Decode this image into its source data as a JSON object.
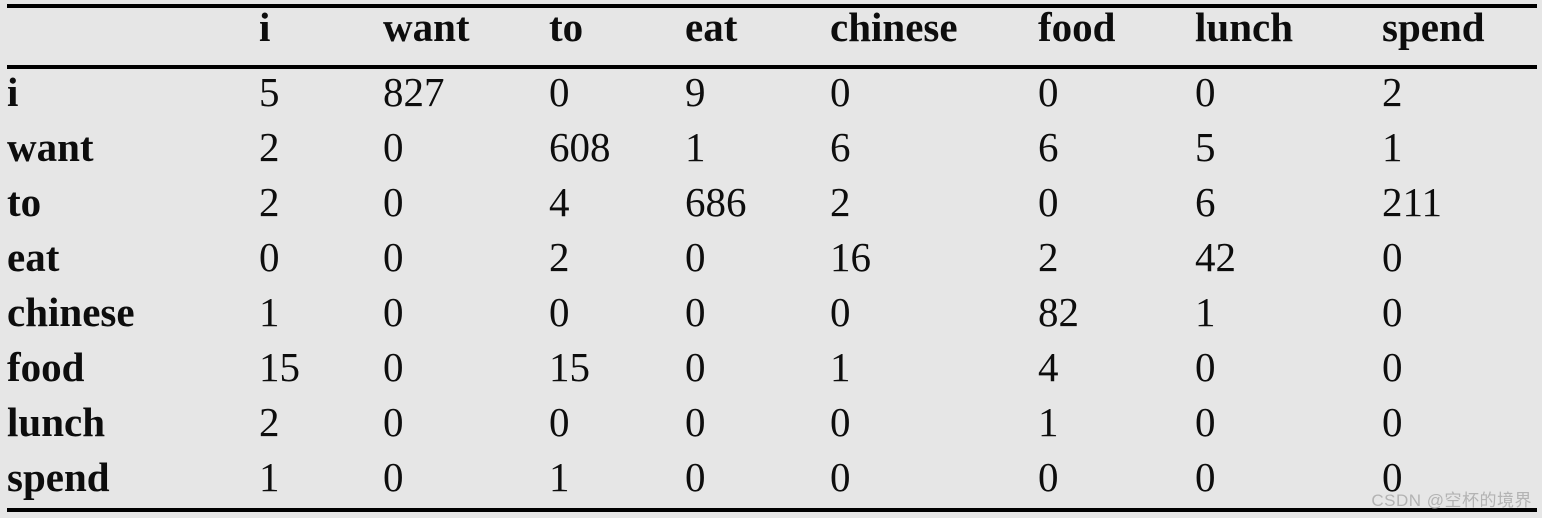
{
  "figure": {
    "kind": "bigram-count-matrix",
    "background_color": "#e6e6e6",
    "rule_color": "#000000",
    "zero_color": "#7f7f7f",
    "value_color": "#0d0d0d"
  },
  "table": {
    "corner_label": "",
    "columns": [
      "i",
      "want",
      "to",
      "eat",
      "chinese",
      "food",
      "lunch",
      "spend"
    ],
    "rows": [
      {
        "label": "i",
        "values": [
          "5",
          "827",
          "0",
          "9",
          "0",
          "0",
          "0",
          "2"
        ]
      },
      {
        "label": "want",
        "values": [
          "2",
          "0",
          "608",
          "1",
          "6",
          "6",
          "5",
          "1"
        ]
      },
      {
        "label": "to",
        "values": [
          "2",
          "0",
          "4",
          "686",
          "2",
          "0",
          "6",
          "211"
        ]
      },
      {
        "label": "eat",
        "values": [
          "0",
          "0",
          "2",
          "0",
          "16",
          "2",
          "42",
          "0"
        ]
      },
      {
        "label": "chinese",
        "values": [
          "1",
          "0",
          "0",
          "0",
          "0",
          "82",
          "1",
          "0"
        ]
      },
      {
        "label": "food",
        "values": [
          "15",
          "0",
          "15",
          "0",
          "1",
          "4",
          "0",
          "0"
        ]
      },
      {
        "label": "lunch",
        "values": [
          "2",
          "0",
          "0",
          "0",
          "0",
          "1",
          "0",
          "0"
        ]
      },
      {
        "label": "spend",
        "values": [
          "1",
          "0",
          "1",
          "0",
          "0",
          "0",
          "0",
          "0"
        ]
      }
    ]
  },
  "watermark": {
    "text": "CSDN @空杯的境界"
  }
}
